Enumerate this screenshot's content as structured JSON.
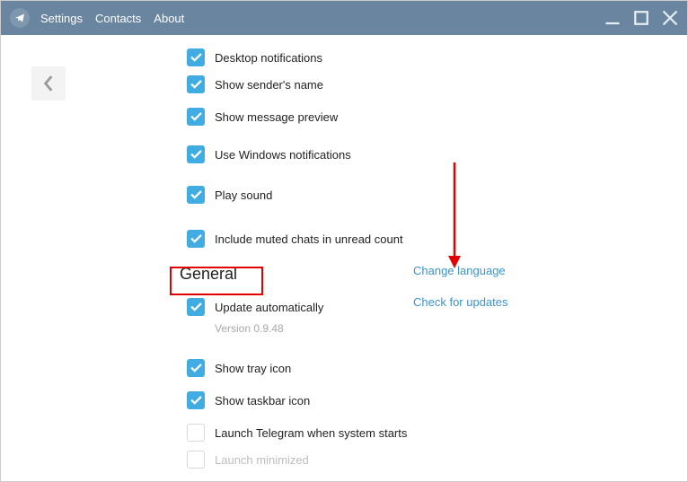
{
  "menu": {
    "settings": "Settings",
    "contacts": "Contacts",
    "about": "About"
  },
  "notifications": {
    "desktop": "Desktop notifications",
    "sender": "Show sender's name",
    "preview": "Show message preview",
    "windows": "Use Windows notifications",
    "sound": "Play sound",
    "muted": "Include muted chats in unread count"
  },
  "general": {
    "title": "General",
    "update": "Update automatically",
    "version": "Version 0.9.48",
    "tray": "Show tray icon",
    "taskbar": "Show taskbar icon",
    "launch": "Launch Telegram when system starts",
    "minimized": "Launch minimized",
    "change_lang": "Change language",
    "check_updates": "Check for updates"
  }
}
